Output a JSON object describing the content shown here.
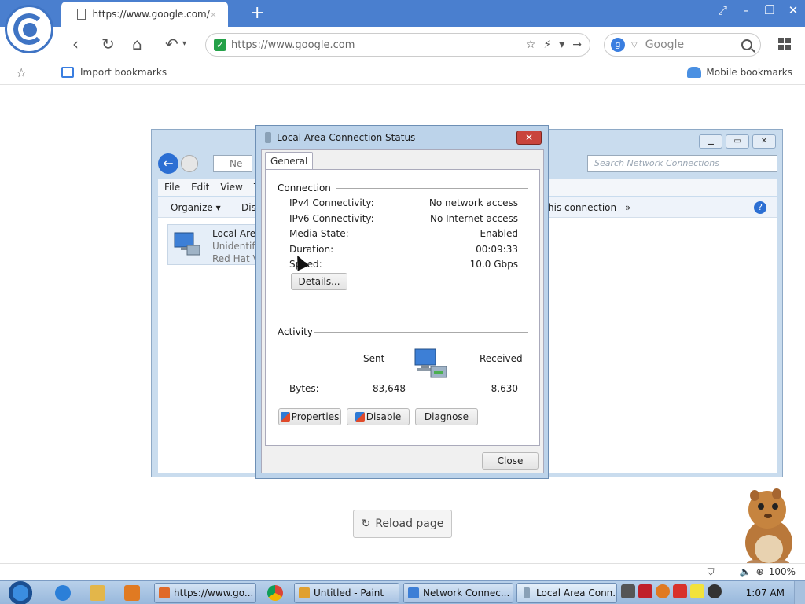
{
  "browser": {
    "tab_title": "https://www.google.com/",
    "tab_close": "×",
    "new_tab": "+",
    "window_controls": [
      "⤢",
      "–",
      "❐",
      "✕"
    ],
    "address_url": "https://www.google.com",
    "search_placeholder": "Google",
    "import_bookmarks": "Import bookmarks",
    "mobile_bookmarks": "Mobile bookmarks",
    "reload_page": "Reload page",
    "zoom_level": "100%"
  },
  "netwin": {
    "crumb": "Ne",
    "search_placeholder": "Search Network Connections",
    "menu": [
      "File",
      "Edit",
      "View",
      "T"
    ],
    "organize": "Organize ▾",
    "disable": "Dis",
    "diagnose": "his connection",
    "more": "»",
    "item": {
      "name": "Local Area",
      "sub1": "Unidentifie",
      "sub2": "Red Hat Vi"
    }
  },
  "dialog": {
    "title": "Local Area Connection Status",
    "close": "✕",
    "tab": "General",
    "connection_heading": "Connection",
    "rows": [
      {
        "label": "IPv4 Connectivity:",
        "value": "No network access"
      },
      {
        "label": "IPv6 Connectivity:",
        "value": "No Internet access"
      },
      {
        "label": "Media State:",
        "value": "Enabled"
      },
      {
        "label": "Duration:",
        "value": "00:09:33"
      },
      {
        "label": "Speed:",
        "value": "10.0 Gbps"
      }
    ],
    "details_button": "Details...",
    "activity_heading": "Activity",
    "sent_label": "Sent",
    "received_label": "Received",
    "bytes_label": "Bytes:",
    "bytes_sent": "83,648",
    "bytes_received": "8,630",
    "properties_button": "Properties",
    "disable_button": "Disable",
    "diagnose_button": "Diagnose",
    "close_button": "Close"
  },
  "taskbar": {
    "buttons": [
      "https://www.go...",
      "Untitled - Paint",
      "Network Connec...",
      "Local Area Conn..."
    ],
    "clock": "1:07 AM"
  }
}
